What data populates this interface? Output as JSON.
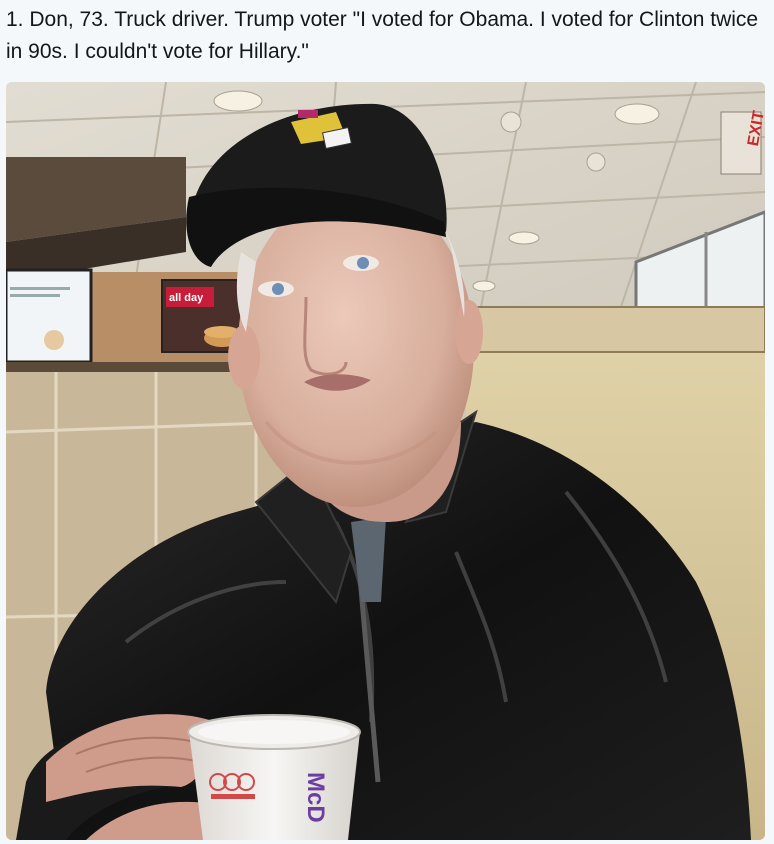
{
  "tweet": {
    "text": "1. Don, 73. Truck driver. Trump voter \"I voted for Obama. I voted for Clinton twice in 90s. I couldn't vote for Hillary.\""
  },
  "photo": {
    "colors": {
      "ceiling": "#dcd6cb",
      "wall_tile": "#c9b79a",
      "booth": "#d9c99e",
      "jacket": "#151515",
      "cap": "#1b1b1b",
      "skin": "#dcb7a6",
      "cup": "#f2f0ee",
      "mc_purple": "#6b3fa0",
      "exit_red": "#c92a2a"
    },
    "signs": {
      "exit": "EXIT",
      "menu_board": "all day",
      "cup_brand": "McD"
    }
  }
}
